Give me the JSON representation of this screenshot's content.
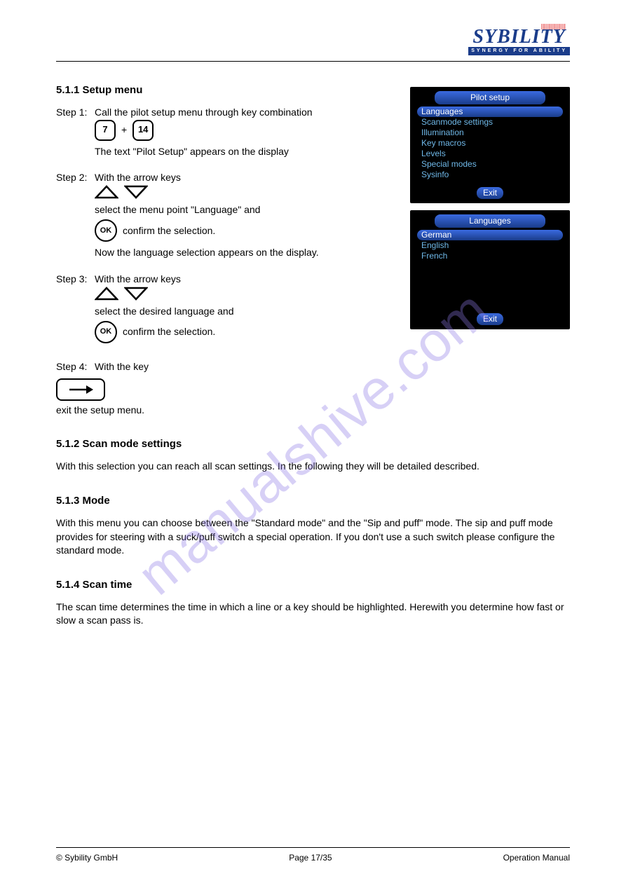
{
  "brand": {
    "name": "SYBILITY",
    "tagline": "SYNERGY FOR ABILITY"
  },
  "watermark": "manualshive.com",
  "sections": {
    "setup_menu": {
      "heading": "5.1.1 Setup menu",
      "step1": {
        "label": "Step 1:",
        "key1": "7",
        "key2": "14",
        "text1": "Call the pilot setup menu through key combination",
        "text2": "The text \"Pilot Setup\" appears on the display"
      },
      "step2": {
        "label": "Step 2:",
        "text1": "With the arrow keys",
        "text2": "select the menu point \"Language\" and",
        "text3": "confirm the selection.",
        "text4": "Now the language selection appears on the display."
      },
      "step3": {
        "label": "Step 3:",
        "text1": "With the arrow keys",
        "text2": "select the desired language and",
        "text3": "confirm the selection."
      },
      "step4": {
        "label": "Step 4:",
        "text1": "With the key",
        "text2": "exit the setup menu."
      },
      "ok_label": "OK"
    },
    "scan": {
      "heading": "5.1.2 Scan mode settings",
      "text": "With this selection you can reach all scan settings. In the following they will be detailed described."
    },
    "mode": {
      "heading": "5.1.3 Mode",
      "text": "With this menu you can choose between the \"Standard mode\" and the \"Sip and puff\" mode. The sip and puff mode provides for steering with a suck/puff switch a special operation. If you don't use a such switch please configure the standard mode."
    },
    "scan_time": {
      "heading": "5.1.4 Scan time",
      "text": "The scan time determines the time in which a line or a key should be highlighted. Herewith you determine how fast or slow a scan pass is."
    }
  },
  "screen1": {
    "title": "Pilot setup",
    "items": [
      "Languages",
      "Scanmode settings",
      "Illumination",
      "Key macros",
      "Levels",
      "Special modes",
      "Sysinfo"
    ],
    "exit": "Exit"
  },
  "screen2": {
    "title": "Languages",
    "items": [
      "German",
      "English",
      "French"
    ],
    "exit": "Exit"
  },
  "footer": {
    "left": "© Sybility GmbH",
    "center": "Page 17/35",
    "right": "Operation Manual"
  }
}
